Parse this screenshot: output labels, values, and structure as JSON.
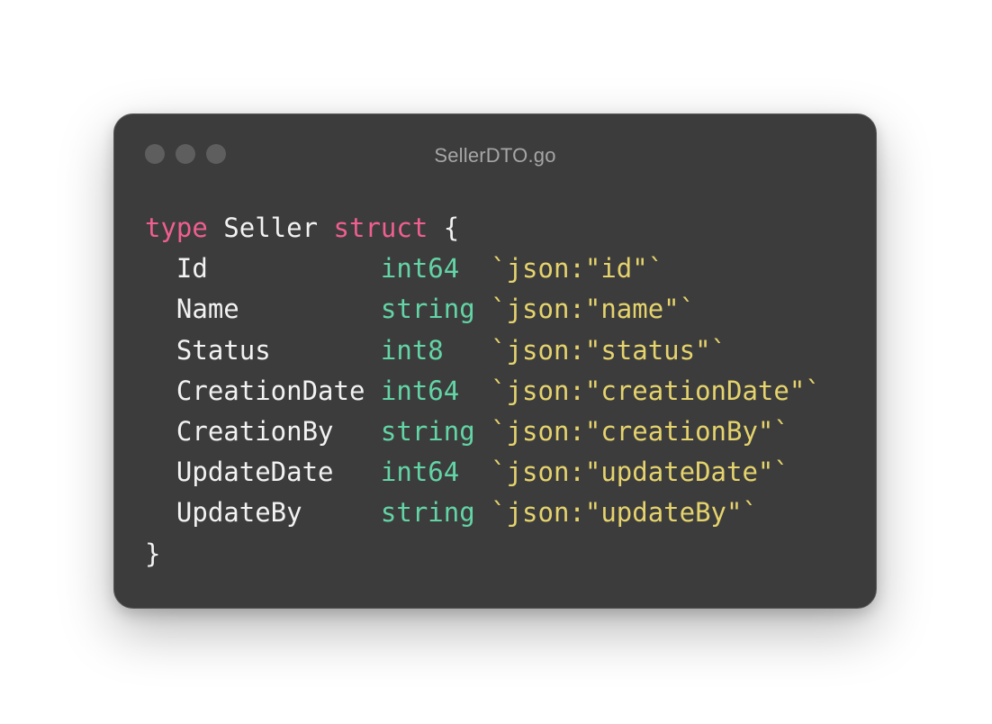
{
  "window": {
    "title": "SellerDTO.go"
  },
  "code": {
    "header": {
      "kw_type": "type",
      "name": " Seller ",
      "kw_struct": "struct",
      "open": " {"
    },
    "fields": [
      {
        "name": "  Id           ",
        "type": "int64  ",
        "tag": "`json:\"id\"`"
      },
      {
        "name": "  Name         ",
        "type": "string ",
        "tag": "`json:\"name\"`"
      },
      {
        "name": "  Status       ",
        "type": "int8   ",
        "tag": "`json:\"status\"`"
      },
      {
        "name": "  CreationDate ",
        "type": "int64  ",
        "tag": "`json:\"creationDate\"`"
      },
      {
        "name": "  CreationBy   ",
        "type": "string ",
        "tag": "`json:\"creationBy\"`"
      },
      {
        "name": "  UpdateDate   ",
        "type": "int64  ",
        "tag": "`json:\"updateDate\"`"
      },
      {
        "name": "  UpdateBy     ",
        "type": "string ",
        "tag": "`json:\"updateBy\"`"
      }
    ],
    "close": "}"
  },
  "colors": {
    "keyword": "#ef5f8f",
    "type": "#63d4a6",
    "tag": "#e5d36d",
    "text": "#f2f2f2",
    "window_bg": "#3c3c3c"
  },
  "icons": [
    "window-dot-icon",
    "window-dot-icon",
    "window-dot-icon"
  ]
}
